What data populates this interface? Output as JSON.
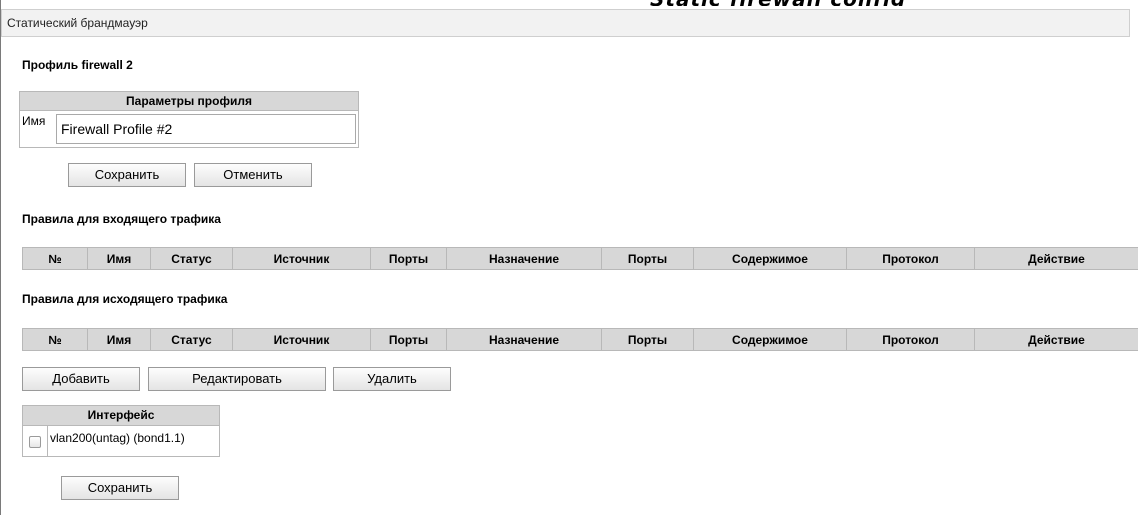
{
  "window": {
    "title": "Статический брандмауэр"
  },
  "profile": {
    "heading": "Профиль firewall 2",
    "params_header": "Параметры профиля",
    "name_label": "Имя",
    "name_value": "Firewall Profile #2",
    "save_label": "Сохранить",
    "cancel_label": "Отменить"
  },
  "incoming": {
    "heading": "Правила для входящего трафика",
    "columns": [
      "№",
      "Имя",
      "Статус",
      "Источник",
      "Порты",
      "Назначение",
      "Порты",
      "Содержимое",
      "Протокол",
      "Действие"
    ]
  },
  "outgoing": {
    "heading": "Правила для исходящего трафика",
    "columns": [
      "№",
      "Имя",
      "Статус",
      "Источник",
      "Порты",
      "Назначение",
      "Порты",
      "Содержимое",
      "Протокол",
      "Действие"
    ]
  },
  "actions": {
    "add_label": "Добавить",
    "edit_label": "Редактировать",
    "delete_label": "Удалить"
  },
  "interfaces": {
    "header": "Интерфейс",
    "items": [
      {
        "label": "vlan200(untag) (bond1.1)",
        "checked": false
      }
    ],
    "save_label": "Сохранить"
  }
}
